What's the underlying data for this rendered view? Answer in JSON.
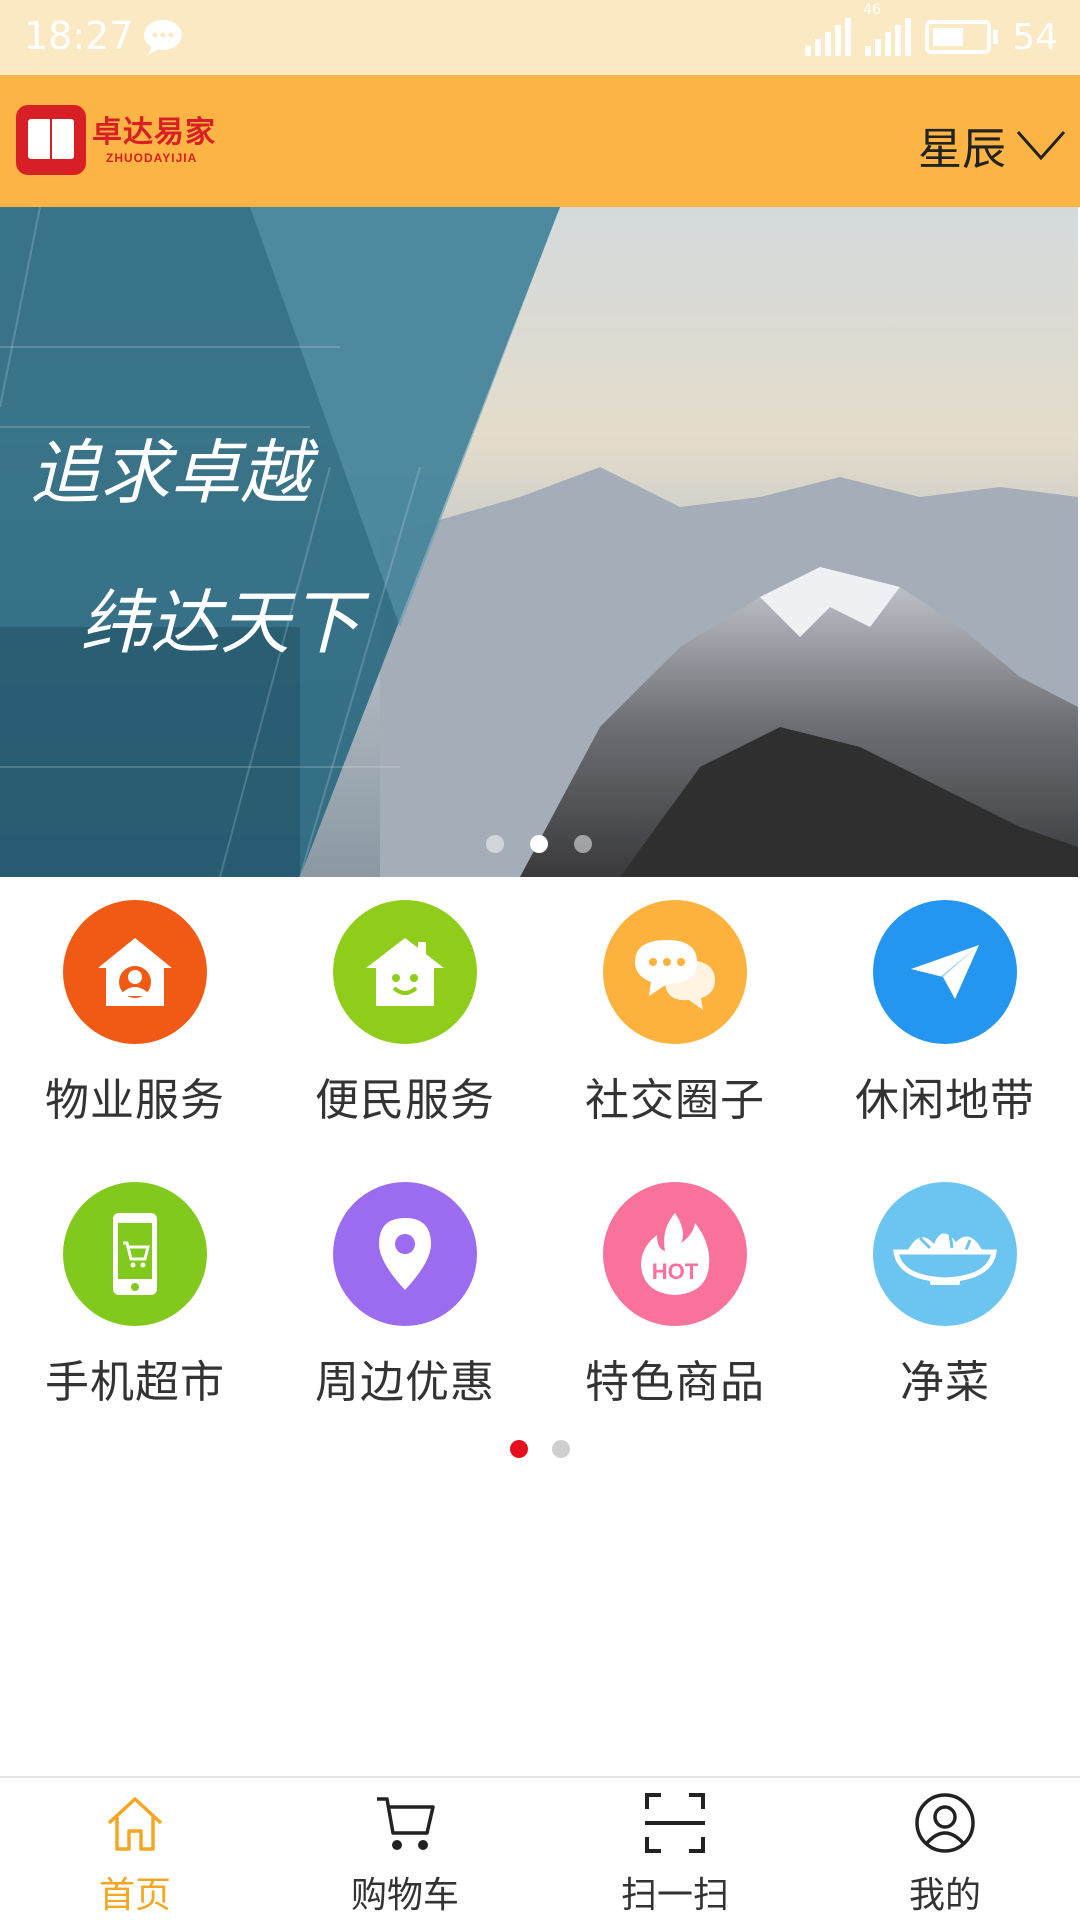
{
  "status_bar": {
    "time": "18:27",
    "network": "46",
    "battery": "54",
    "icons": [
      "wechat-message-icon",
      "signal-icon",
      "signal-4g-icon",
      "battery-icon"
    ]
  },
  "header": {
    "logo_text": "卓达易家",
    "logo_sub": "ZHUODAYIJIA",
    "location": "星辰",
    "background": "#fcb544"
  },
  "banner": {
    "calligraphy_line1": "追求卓越",
    "calligraphy_line2": "纬达天下",
    "slide_count": 3,
    "active_slide": 2
  },
  "services": [
    {
      "label": "物业服务",
      "icon": "property-house-icon",
      "color": "#f05a14"
    },
    {
      "label": "便民服务",
      "icon": "smiling-house-icon",
      "color": "#8fcd1a"
    },
    {
      "label": "社交圈子",
      "icon": "chat-bubbles-icon",
      "color": "#fcb23d"
    },
    {
      "label": "休闲地带",
      "icon": "paper-plane-icon",
      "color": "#2496f0"
    },
    {
      "label": "手机超市",
      "icon": "phone-cart-icon",
      "color": "#82c91e"
    },
    {
      "label": "周边优惠",
      "icon": "location-pin-icon",
      "color": "#9b6cf0"
    },
    {
      "label": "特色商品",
      "icon": "hot-flame-icon",
      "color": "#f8729c"
    },
    {
      "label": "净菜",
      "icon": "vegetable-bowl-icon",
      "color": "#6cc4f0"
    }
  ],
  "grid_pages": {
    "count": 2,
    "active": 1
  },
  "bottom_nav": [
    {
      "label": "首页",
      "icon": "home-icon",
      "active": true
    },
    {
      "label": "购物车",
      "icon": "cart-icon",
      "active": false
    },
    {
      "label": "扫一扫",
      "icon": "scan-icon",
      "active": false
    },
    {
      "label": "我的",
      "icon": "profile-icon",
      "active": false
    }
  ],
  "colors": {
    "accent": "#f5a623",
    "dot_active": "#e60f1e"
  }
}
